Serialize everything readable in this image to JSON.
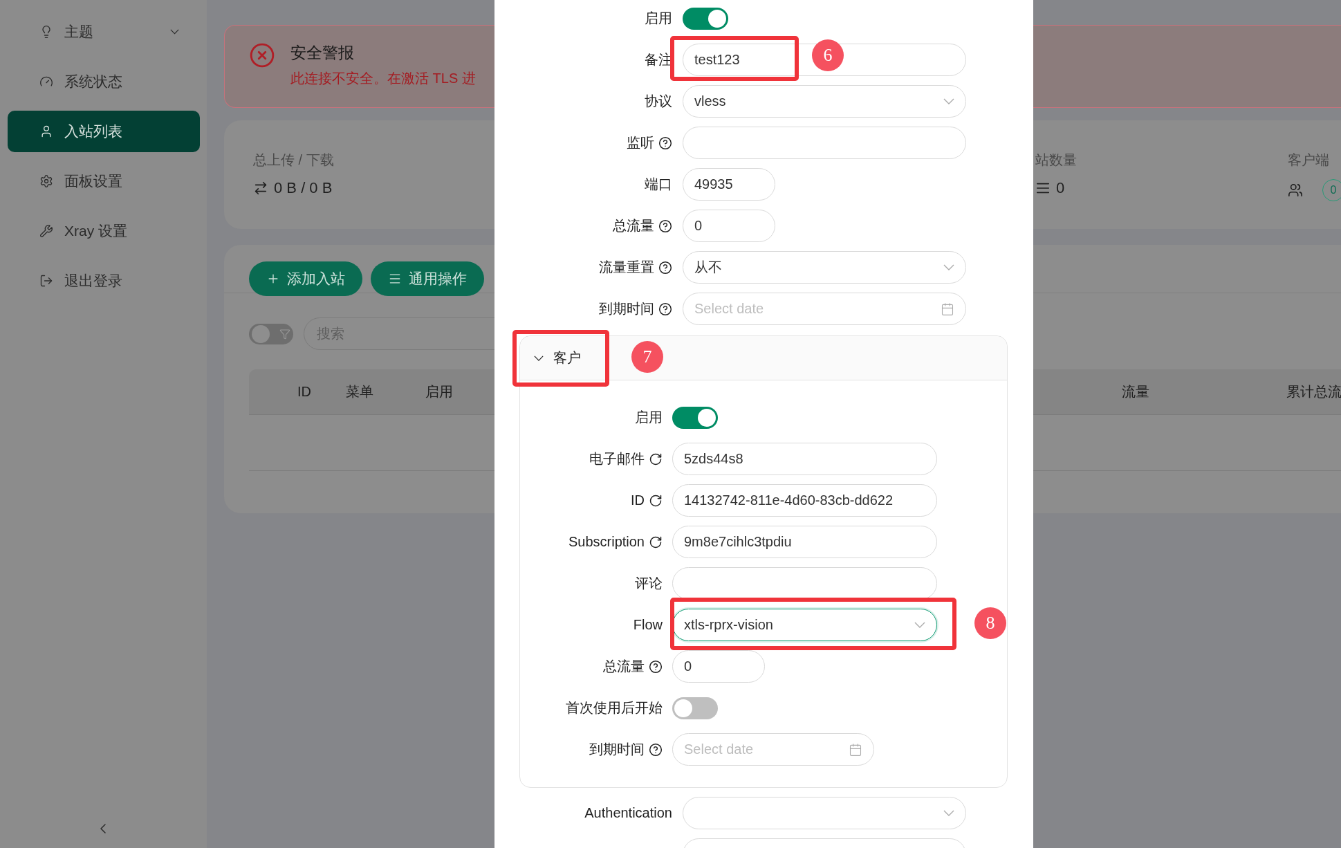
{
  "sidebar": {
    "items": [
      {
        "label": "主题",
        "selected": false,
        "expandable": true
      },
      {
        "label": "系统状态",
        "selected": false
      },
      {
        "label": "入站列表",
        "selected": true
      },
      {
        "label": "面板设置",
        "selected": false
      },
      {
        "label": "Xray 设置",
        "selected": false
      },
      {
        "label": "退出登录",
        "selected": false
      }
    ]
  },
  "alert": {
    "title": "安全警报",
    "message": "此连接不安全。在激活 TLS 进"
  },
  "stats": [
    {
      "label": "总上传 / 下载",
      "value": "0 B / 0 B"
    },
    {
      "label": "站数量",
      "value": "0"
    },
    {
      "label": "客户端",
      "badge": "0"
    }
  ],
  "toolbar": {
    "buttons": [
      {
        "label": "添加入站"
      },
      {
        "label": "通用操作"
      }
    ],
    "filter_on": false,
    "search": {
      "placeholder": "搜索"
    }
  },
  "table": {
    "columns": [
      "ID",
      "菜单",
      "启用",
      "流量",
      "累计总流"
    ]
  },
  "modal": {
    "fields": [
      {
        "kind": "switch",
        "label": "启用",
        "on": true
      },
      {
        "kind": "text",
        "label": "备注",
        "value": "test123"
      },
      {
        "kind": "select",
        "label": "协议",
        "value": "vless"
      },
      {
        "kind": "text",
        "label": "监听",
        "help": true
      },
      {
        "kind": "short",
        "label": "端口",
        "value": "49935"
      },
      {
        "kind": "short",
        "label": "总流量",
        "help": true,
        "value": "0"
      },
      {
        "kind": "select",
        "label": "流量重置",
        "help": true,
        "value": "从不"
      },
      {
        "kind": "date",
        "label": "到期时间",
        "help": true,
        "placeholder": "Select date"
      }
    ],
    "client": {
      "title": "客户",
      "expanded": true,
      "fields": [
        {
          "kind": "switch",
          "label": "启用",
          "on": true
        },
        {
          "kind": "text",
          "label": "电子邮件",
          "refresh": true,
          "value": "5zds44s8"
        },
        {
          "kind": "text",
          "label": "ID",
          "refresh": true,
          "value": "14132742-811e-4d60-83cb-dd622"
        },
        {
          "kind": "text",
          "label": "Subscription",
          "refresh": true,
          "value": "9m8e7cihlc3tpdiu"
        },
        {
          "kind": "text",
          "label": "评论"
        },
        {
          "kind": "select",
          "label": "Flow",
          "value": "xtls-rprx-vision",
          "focused": true
        },
        {
          "kind": "short",
          "label": "总流量",
          "help": true,
          "value": "0"
        },
        {
          "kind": "switch",
          "label": "首次使用后开始",
          "on": false
        },
        {
          "kind": "short-date",
          "label": "到期时间",
          "help": true,
          "placeholder": "Select date"
        }
      ]
    },
    "after_fields": [
      {
        "kind": "select",
        "label": "Authentication"
      },
      {
        "kind": "text"
      }
    ]
  },
  "annotations": [
    {
      "number": "6"
    },
    {
      "number": "7"
    },
    {
      "number": "8"
    }
  ]
}
